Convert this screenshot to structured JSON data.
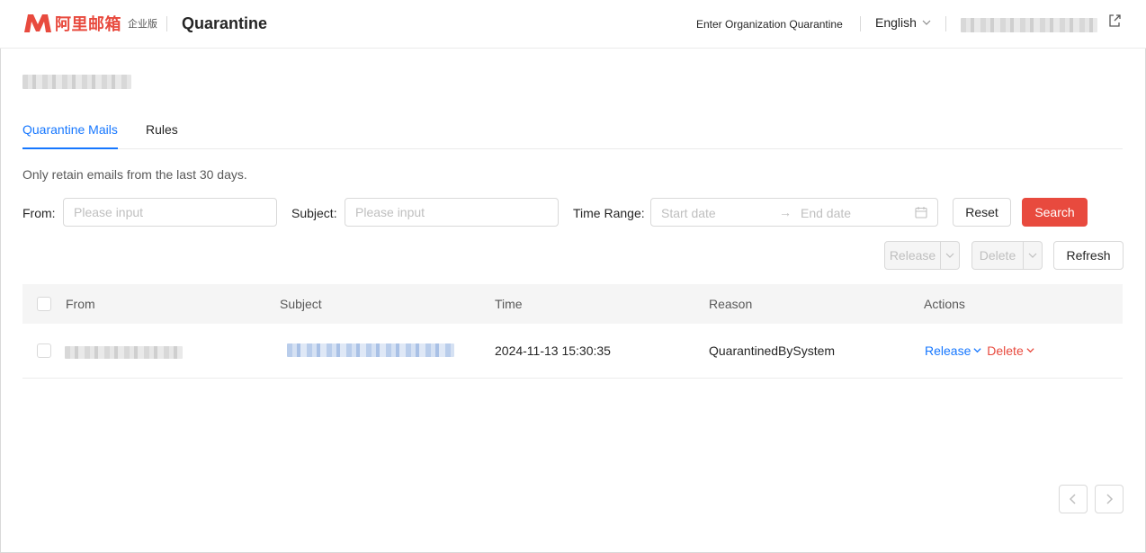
{
  "header": {
    "brand_cn": "阿里邮箱",
    "brand_edition": "企业版",
    "title": "Quarantine",
    "org_link": "Enter Organization Quarantine",
    "language": "English"
  },
  "tabs": [
    {
      "label": "Quarantine Mails",
      "active": true
    },
    {
      "label": "Rules",
      "active": false
    }
  ],
  "notice": "Only retain emails from the last 30 days.",
  "filters": {
    "from_label": "From:",
    "from_placeholder": "Please input",
    "subject_label": "Subject:",
    "subject_placeholder": "Please input",
    "time_label": "Time Range:",
    "start_placeholder": "Start date",
    "end_placeholder": "End date",
    "reset": "Reset",
    "search": "Search"
  },
  "toolbar": {
    "release": "Release",
    "delete": "Delete",
    "refresh": "Refresh"
  },
  "table": {
    "columns": [
      "From",
      "Subject",
      "Time",
      "Reason",
      "Actions"
    ],
    "rows": [
      {
        "time": "2024-11-13 15:30:35",
        "reason": "QuarantinedBySystem",
        "action_release": "Release",
        "action_delete": "Delete"
      }
    ]
  },
  "colors": {
    "accent": "#e84a3e",
    "link": "#1677ff"
  }
}
